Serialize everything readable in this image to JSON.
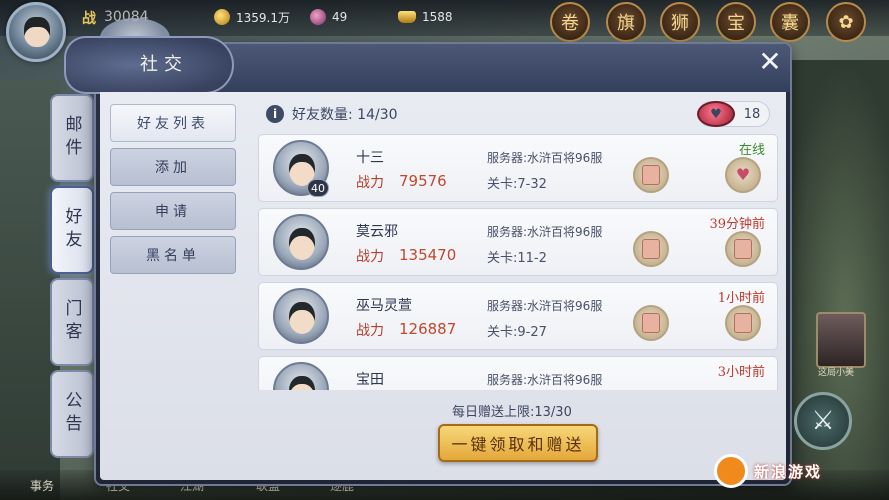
{
  "topbar": {
    "power_label": "战",
    "power_value": "30084",
    "coins": "1359.1万",
    "gems": "49",
    "ingots": "1588",
    "icons": [
      "scroll-icon",
      "war-flag-icon",
      "lion-icon",
      "treasure-icon",
      "pouch-icon",
      "flower-icon"
    ]
  },
  "panel": {
    "title": "社交",
    "close_glyph": "✕"
  },
  "side_tabs": [
    {
      "label": "邮件",
      "active": false
    },
    {
      "label": "好友",
      "active": true
    },
    {
      "label": "门客",
      "active": false
    },
    {
      "label": "公告",
      "active": false
    }
  ],
  "subnav": [
    {
      "label": "好友列表",
      "active": true
    },
    {
      "label": "添加",
      "active": false
    },
    {
      "label": "申请",
      "active": false
    },
    {
      "label": "黑名单",
      "active": false
    }
  ],
  "friends_header": {
    "info_glyph": "i",
    "count_label": "好友数量: 14/30",
    "gift_count": "18"
  },
  "friends": [
    {
      "name": "十三",
      "level": "40",
      "power_label": "战力",
      "power": "79576",
      "server": "服务器:水浒百将96服",
      "stage": "关卡:7-32",
      "status": "在线",
      "online": true
    },
    {
      "name": "莫云邪",
      "level": "",
      "power_label": "战力",
      "power": "135470",
      "server": "服务器:水浒百将96服",
      "stage": "关卡:11-2",
      "status": "39分钟前",
      "online": false
    },
    {
      "name": "巫马灵萱",
      "level": "",
      "power_label": "战力",
      "power": "126887",
      "server": "服务器:水浒百将96服",
      "stage": "关卡:9-27",
      "status": "1小时前",
      "online": false
    },
    {
      "name": "宝田",
      "level": "",
      "power_label": "战力",
      "power": "",
      "server": "服务器:水浒百将96服",
      "stage": "",
      "status": "3小时前",
      "online": false
    }
  ],
  "footer": {
    "daily_limit": "每日赠送上限:13/30",
    "claim_button": "一键领取和赠送"
  },
  "background": {
    "bottom_labels": [
      "事务",
      "社交",
      "江湖",
      "联盟",
      "逐鹿"
    ],
    "side_portrait_label": "这局小美"
  },
  "watermark": {
    "text": "新浪游戏"
  }
}
